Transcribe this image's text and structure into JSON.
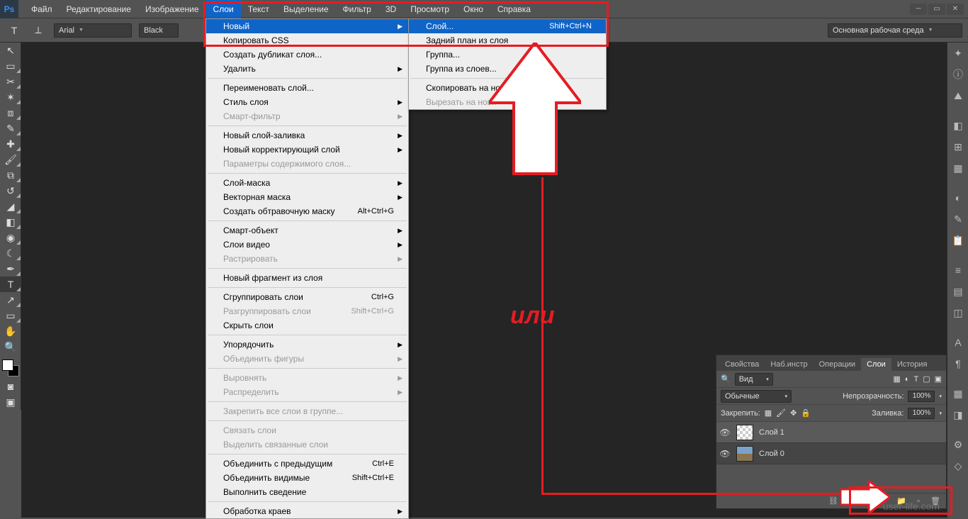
{
  "menubar": {
    "items": [
      "Файл",
      "Редактирование",
      "Изображение",
      "Слои",
      "Текст",
      "Выделение",
      "Фильтр",
      "3D",
      "Просмотр",
      "Окно",
      "Справка"
    ]
  },
  "optbar": {
    "font": "Arial",
    "style": "Black",
    "workspace": "Основная рабочая среда"
  },
  "layerMenu": [
    {
      "t": "item",
      "label": "Новый",
      "arrow": true,
      "hl": true
    },
    {
      "t": "item",
      "label": "Копировать CSS"
    },
    {
      "t": "item",
      "label": "Создать дубликат слоя..."
    },
    {
      "t": "item",
      "label": "Удалить",
      "arrow": true
    },
    {
      "t": "sep"
    },
    {
      "t": "item",
      "label": "Переименовать слой..."
    },
    {
      "t": "item",
      "label": "Стиль слоя",
      "arrow": true
    },
    {
      "t": "item",
      "label": "Смарт-фильтр",
      "arrow": true,
      "dis": true
    },
    {
      "t": "sep"
    },
    {
      "t": "item",
      "label": "Новый слой-заливка",
      "arrow": true
    },
    {
      "t": "item",
      "label": "Новый корректирующий слой",
      "arrow": true
    },
    {
      "t": "item",
      "label": "Параметры содержимого слоя...",
      "dis": true
    },
    {
      "t": "sep"
    },
    {
      "t": "item",
      "label": "Слой-маска",
      "arrow": true
    },
    {
      "t": "item",
      "label": "Векторная маска",
      "arrow": true
    },
    {
      "t": "item",
      "label": "Создать обтравочную маску",
      "shortcut": "Alt+Ctrl+G"
    },
    {
      "t": "sep"
    },
    {
      "t": "item",
      "label": "Смарт-объект",
      "arrow": true
    },
    {
      "t": "item",
      "label": "Слои видео",
      "arrow": true
    },
    {
      "t": "item",
      "label": "Растрировать",
      "arrow": true,
      "dis": true
    },
    {
      "t": "sep"
    },
    {
      "t": "item",
      "label": "Новый фрагмент из слоя"
    },
    {
      "t": "sep"
    },
    {
      "t": "item",
      "label": "Сгруппировать слои",
      "shortcut": "Ctrl+G"
    },
    {
      "t": "item",
      "label": "Разгруппировать слои",
      "shortcut": "Shift+Ctrl+G",
      "dis": true
    },
    {
      "t": "item",
      "label": "Скрыть слои"
    },
    {
      "t": "sep"
    },
    {
      "t": "item",
      "label": "Упорядочить",
      "arrow": true
    },
    {
      "t": "item",
      "label": "Объединить фигуры",
      "arrow": true,
      "dis": true
    },
    {
      "t": "sep"
    },
    {
      "t": "item",
      "label": "Выровнять",
      "arrow": true,
      "dis": true
    },
    {
      "t": "item",
      "label": "Распределить",
      "arrow": true,
      "dis": true
    },
    {
      "t": "sep"
    },
    {
      "t": "item",
      "label": "Закрепить все слои в группе...",
      "dis": true
    },
    {
      "t": "sep"
    },
    {
      "t": "item",
      "label": "Связать слои",
      "dis": true
    },
    {
      "t": "item",
      "label": "Выделить связанные слои",
      "dis": true
    },
    {
      "t": "sep"
    },
    {
      "t": "item",
      "label": "Объединить с предыдущим",
      "shortcut": "Ctrl+E"
    },
    {
      "t": "item",
      "label": "Объединить видимые",
      "shortcut": "Shift+Ctrl+E"
    },
    {
      "t": "item",
      "label": "Выполнить сведение"
    },
    {
      "t": "sep"
    },
    {
      "t": "item",
      "label": "Обработка краев",
      "arrow": true
    }
  ],
  "submenu": [
    {
      "t": "item",
      "label": "Слой...",
      "shortcut": "Shift+Ctrl+N",
      "hl": true
    },
    {
      "t": "item",
      "label": "Задний план из слоя"
    },
    {
      "t": "item",
      "label": "Группа..."
    },
    {
      "t": "item",
      "label": "Группа из слоев..."
    },
    {
      "t": "sep"
    },
    {
      "t": "item",
      "label": "Скопировать на нов"
    },
    {
      "t": "item",
      "label": "Вырезать на нови",
      "dis": true
    }
  ],
  "panels": {
    "tabs": [
      "Свойства",
      "Наб.инстр",
      "Операции",
      "Слои",
      "История"
    ],
    "kindLabel": "Вид",
    "blend": "Обычные",
    "opacityLabel": "Непрозрачность:",
    "opacity": "100%",
    "lockLabel": "Закрепить:",
    "fillLabel": "Заливка:",
    "fill": "100%",
    "layers": [
      {
        "name": "Слой 1"
      },
      {
        "name": "Слой 0"
      }
    ]
  },
  "annot": {
    "or": "или",
    "wm": "user-life.com"
  }
}
